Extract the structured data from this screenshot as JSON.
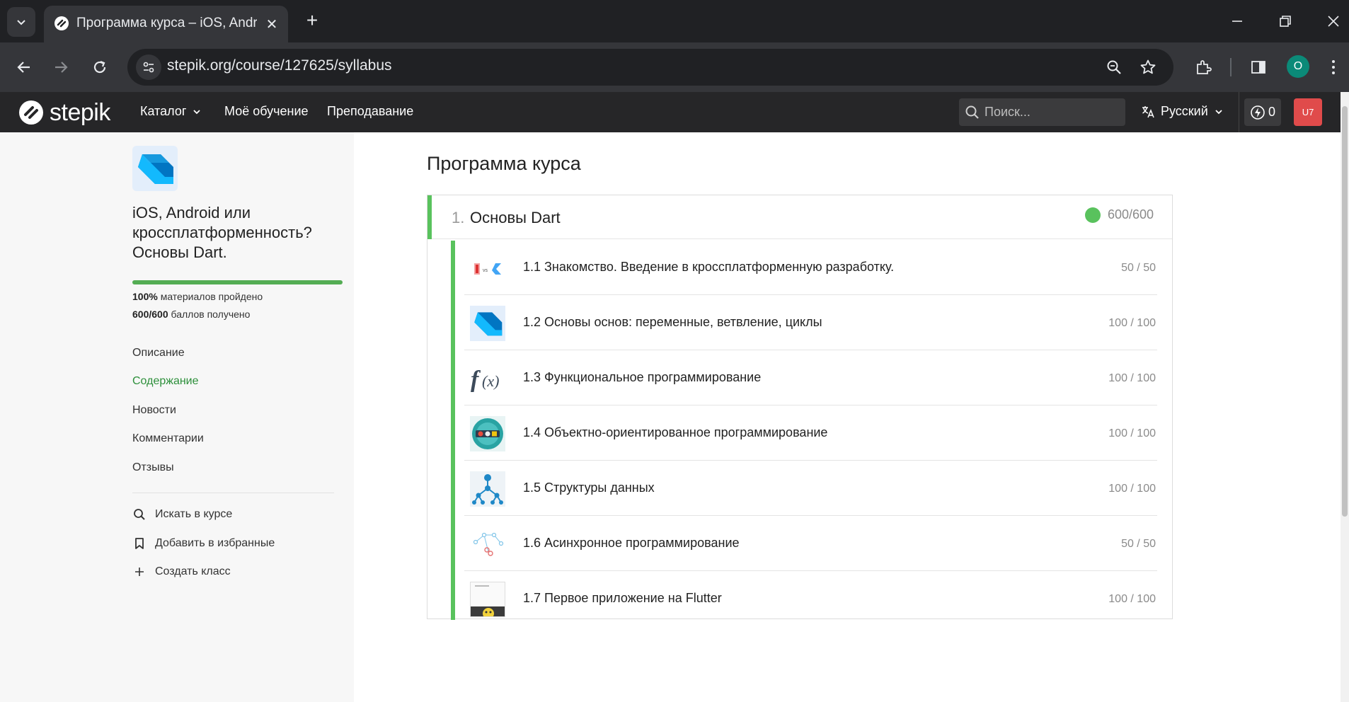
{
  "browser": {
    "tab_title": "Программа курса – iOS, Android или кроссплатформенность? Основы Dart.",
    "url": "stepik.org/course/127625/syllabus",
    "profile_initial": "O"
  },
  "header": {
    "logo_text": "stepik",
    "nav": {
      "catalog": "Каталог",
      "my_learning": "Моё обучение",
      "teaching": "Преподавание"
    },
    "search_placeholder": "Поиск...",
    "language": "Русский",
    "energy_count": "0",
    "user_initials": "U7"
  },
  "sidebar": {
    "course_title": "iOS, Android или кроссплатформенность? Основы Dart.",
    "progress_percent": 100,
    "materials_value": "100%",
    "materials_text": " материалов пройдено",
    "points_value": "600/600",
    "points_text": " баллов получено",
    "menu": {
      "description": "Описание",
      "contents": "Содержание",
      "news": "Новости",
      "comments": "Комментарии",
      "reviews": "Отзывы"
    },
    "actions": {
      "search": "Искать в курсе",
      "favorite": "Добавить в избранные",
      "create_class": "Создать класс"
    }
  },
  "main": {
    "page_title": "Программа курса",
    "module": {
      "number": "1.",
      "title": "Основы Dart",
      "score": "600/600",
      "lessons": [
        {
          "title": "1.1 Знакомство. Введение в кроссплатформенную разработку.",
          "score": "50 / 50"
        },
        {
          "title": "1.2 Основы основ: переменные, ветвление, циклы",
          "score": "100 / 100"
        },
        {
          "title": "1.3 Функциональное программирование",
          "score": "100 / 100"
        },
        {
          "title": "1.4 Объектно-ориентированное программирование",
          "score": "100 / 100"
        },
        {
          "title": "1.5 Структуры данных",
          "score": "100 / 100"
        },
        {
          "title": "1.6 Асинхронное программирование",
          "score": "50 / 50"
        },
        {
          "title": "1.7 Первое приложение на Flutter",
          "score": "100 / 100"
        }
      ]
    }
  },
  "colors": {
    "accent_green": "#59c25d",
    "active_link": "#2c8f3a",
    "header_bg": "#262628",
    "user_badge": "#e04b4b"
  }
}
